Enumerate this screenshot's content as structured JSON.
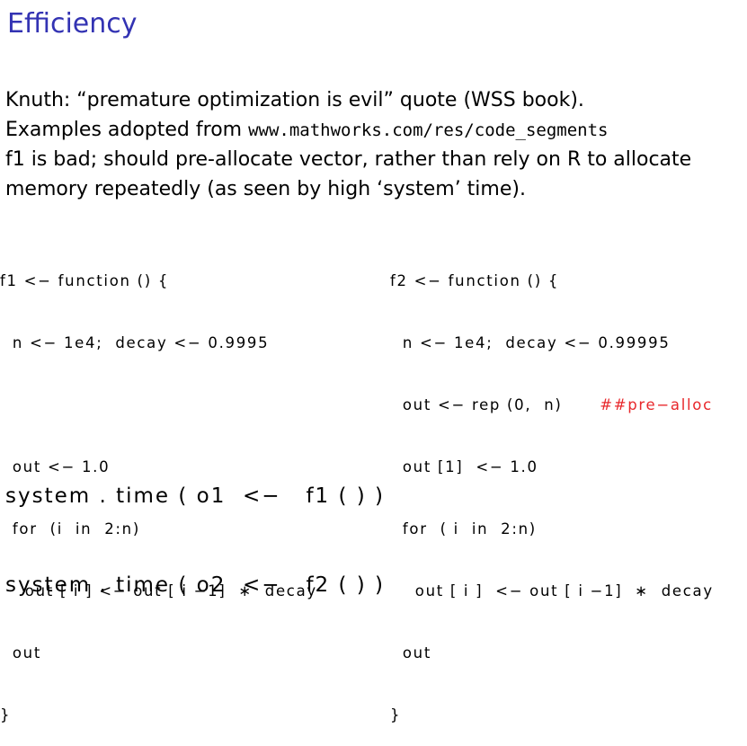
{
  "title": "Efficiency",
  "colors": {
    "title": "#3333b3",
    "comment": "#e8272b",
    "text": "#000000"
  },
  "body": {
    "line1": "Knuth: “premature optimization is evil” quote (WSS book).",
    "line2_prefix": "Examples adopted from ",
    "line2_url": "www.mathworks.com/res/code_segments",
    "line3": "f1 is bad; should pre-allocate vector, rather than rely on R to allocate",
    "line4": "memory repeatedly (as seen by high ‘system’ time)."
  },
  "code_f1": [
    "f1 <− function () {",
    "  n <− 1e4;  decay <− 0.9995",
    "",
    "  out <− 1.0",
    "  for  (i  in  2:n)",
    "    out [ i ] <− out [ i −1]  ∗  decay",
    "  out",
    "}"
  ],
  "code_f2": [
    "f2 <− function () {",
    "  n <− 1e4;  decay <− 0.99995",
    "  out <− rep (0,  n)",
    "  out [1]  <− 1.0",
    "  for  ( i  in  2:n)",
    "    out [ i ]  <− out [ i −1]  ∗  decay",
    "  out",
    "}"
  ],
  "code_f2_comment": "##pre−alloc",
  "calls": [
    "system . time ( o1  <−   f1 ( ) )",
    "system . time ( o2  <−   f2 ( ) )"
  ]
}
